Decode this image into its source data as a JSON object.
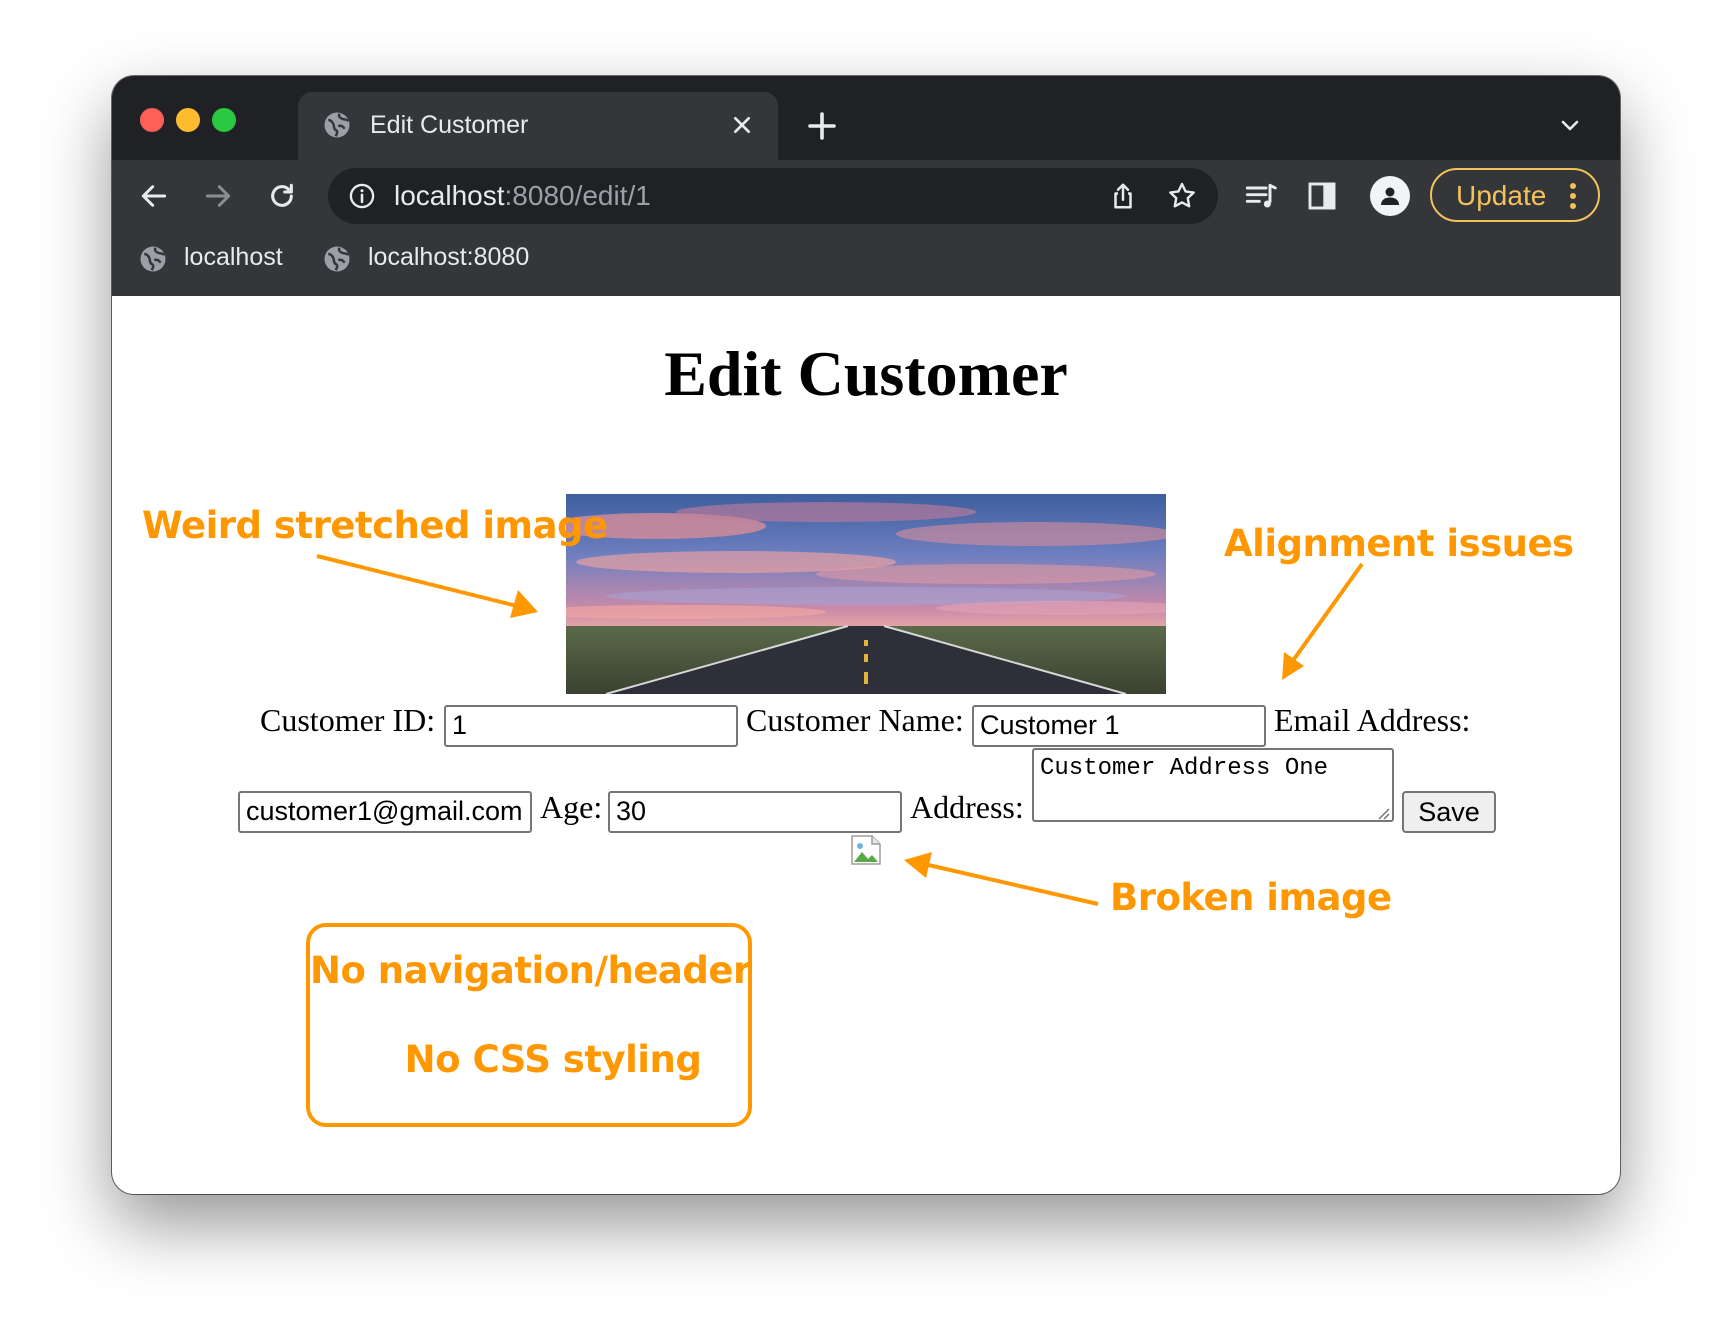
{
  "browser": {
    "tab_title": "Edit Customer",
    "url_host": "localhost",
    "url_rest": ":8080/edit/1",
    "update_label": "Update",
    "bookmarks": [
      "localhost",
      "localhost:8080"
    ],
    "colors": {
      "frame": "#202124",
      "toolbar": "#35363a",
      "accent": "#f2c25b"
    },
    "icons": [
      "globe-icon",
      "close-icon",
      "plus-icon",
      "chevron-down-icon",
      "back-icon",
      "forward-icon",
      "reload-icon",
      "info-icon",
      "share-icon",
      "star-icon",
      "media-queue-icon",
      "side-panel-icon",
      "profile-icon",
      "kebab-menu-icon"
    ]
  },
  "page": {
    "title": "Edit Customer",
    "form": {
      "customer_id_label": "Customer ID:",
      "customer_id_value": "1",
      "customer_name_label": "Customer Name:",
      "customer_name_value": "Customer 1",
      "email_label": "Email Address:",
      "email_value": "customer1@gmail.com",
      "age_label": "Age:",
      "age_value": "30",
      "address_label": "Address:",
      "address_value": "Customer Address One",
      "save_label": "Save"
    }
  },
  "annotations": {
    "stretched_image": "Weird stretched image",
    "alignment": "Alignment issues",
    "broken_image": "Broken image",
    "no_nav": "No navigation/header",
    "no_css": "No CSS styling",
    "color": "#ff9800"
  }
}
